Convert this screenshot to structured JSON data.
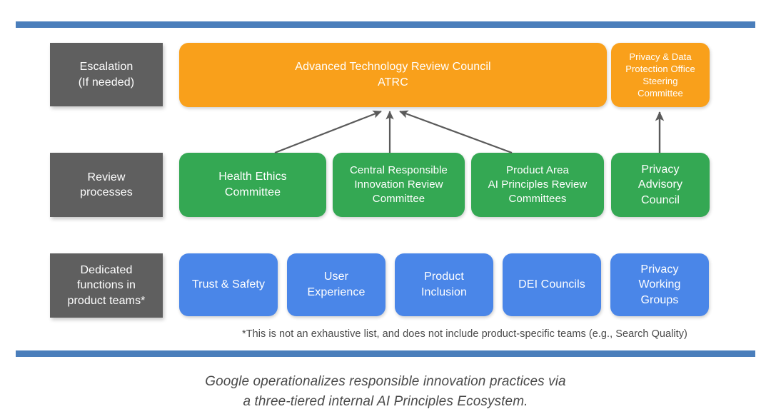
{
  "colors": {
    "rule": "#4a7ebb",
    "tier_label_bg": "#5f5f5f",
    "escalation": "#f9a01b",
    "review": "#34a853",
    "dedicated": "#4a86e8",
    "connector": "#5a5a5a",
    "text_body": "#4a4a4a"
  },
  "rows": [
    {
      "id": "escalation",
      "label": "Escalation\n(If needed)",
      "nodes": [
        {
          "id": "atrc",
          "label": "Advanced Technology Review Council\nATRC"
        },
        {
          "id": "pdpo-steering",
          "label": "Privacy & Data\nProtection Office\nSteering\nCommittee"
        }
      ]
    },
    {
      "id": "review-processes",
      "label": "Review\nprocesses",
      "nodes": [
        {
          "id": "health-ethics",
          "label": "Health  Ethics\nCommittee"
        },
        {
          "id": "central-rir",
          "label": "Central Responsible\nInnovation Review\nCommittee"
        },
        {
          "id": "pa-aiprc",
          "label": "Product Area\nAI Principles Review\nCommittees"
        },
        {
          "id": "privacy-advisory",
          "label": "Privacy\nAdvisory\nCouncil"
        }
      ]
    },
    {
      "id": "dedicated-functions",
      "label": "Dedicated\nfunctions in\nproduct teams*",
      "nodes": [
        {
          "id": "trust-safety",
          "label": "Trust & Safety"
        },
        {
          "id": "user-experience",
          "label": "User\nExperience"
        },
        {
          "id": "product-inclusion",
          "label": "Product\nInclusion"
        },
        {
          "id": "dei-councils",
          "label": "DEI Councils"
        },
        {
          "id": "privacy-working-groups",
          "label": "Privacy\nWorking\nGroups"
        }
      ]
    }
  ],
  "footnote": "*This is not an exhaustive list, and does not include product-specific teams (e.g., Search Quality)",
  "caption": "Google operationalizes responsible innovation practices via\na three-tiered internal AI Principles Ecosystem."
}
